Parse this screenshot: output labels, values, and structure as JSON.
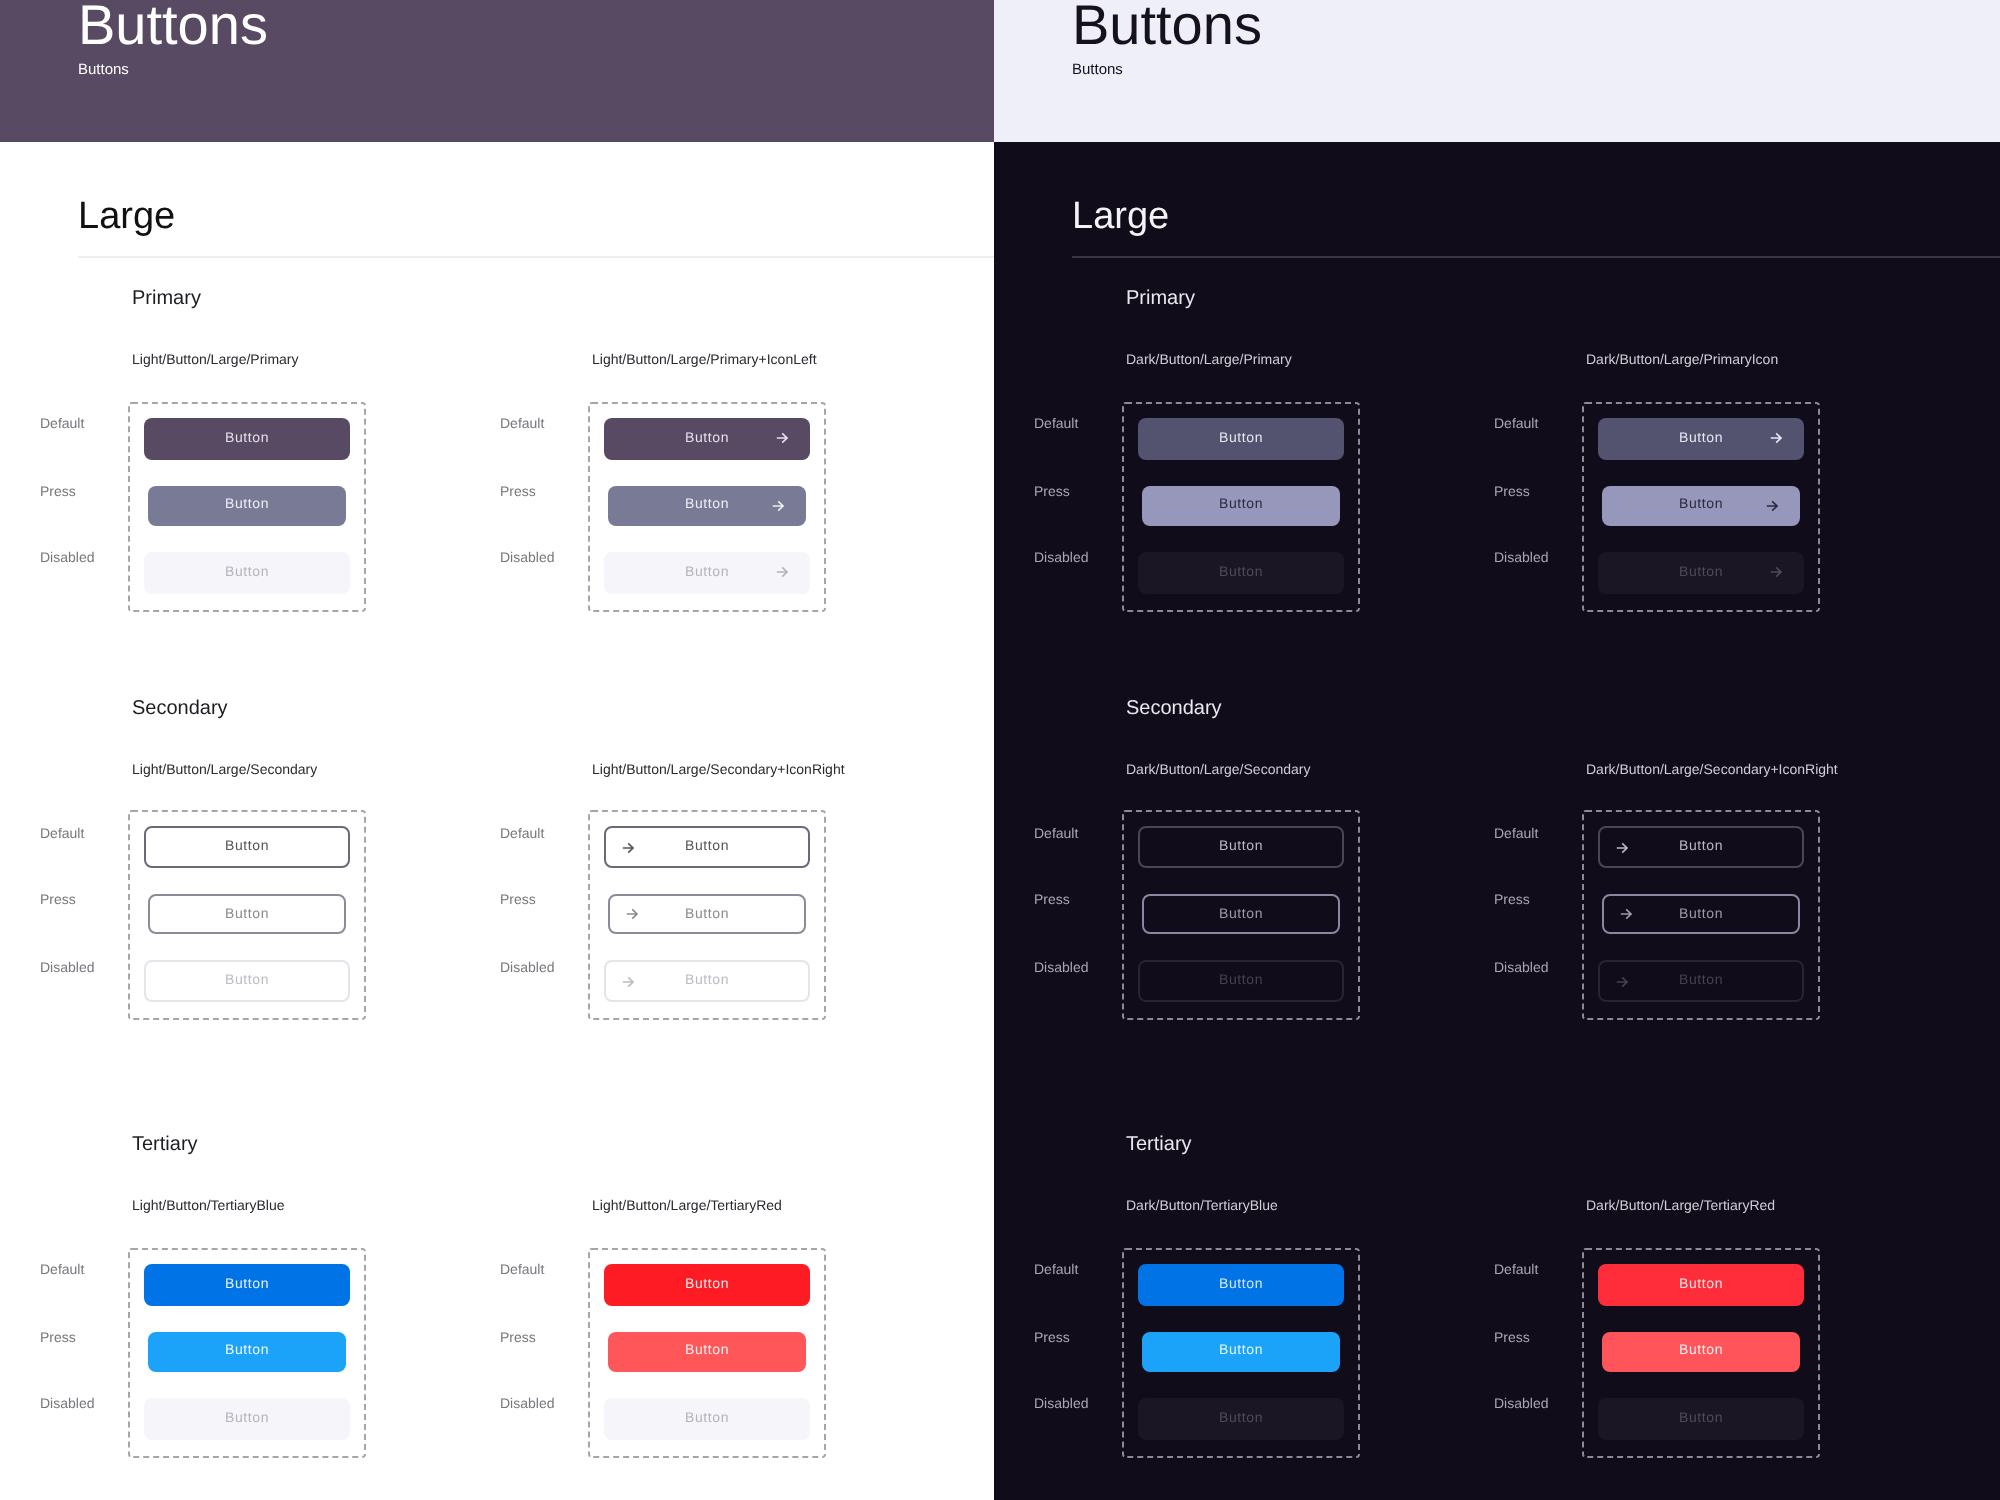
{
  "panels": [
    {
      "kind": "light",
      "header": {
        "title": "Buttons",
        "subtitle": "Buttons"
      },
      "heading": "Large",
      "sections": [
        {
          "title": "Primary",
          "variants": [
            {
              "label": "Light/Button/Large/Primary",
              "kind": "primary",
              "arrow_left": false,
              "arrow_right": false,
              "rows": [
                {
                  "state": "Default",
                  "button": {
                    "text": "Button",
                    "pressed": false,
                    "disabled": false
                  }
                },
                {
                  "state": "Press",
                  "button": {
                    "text": "Button",
                    "pressed": true,
                    "disabled": false
                  }
                },
                {
                  "state": "Disabled",
                  "button": {
                    "text": "Button",
                    "pressed": false,
                    "disabled": true
                  }
                }
              ]
            },
            {
              "label": "Light/Button/Large/Primary+IconLeft",
              "kind": "primary",
              "arrow_left": false,
              "arrow_right": true,
              "rows": [
                {
                  "state": "Default",
                  "button": {
                    "text": "Button",
                    "pressed": false,
                    "disabled": false
                  }
                },
                {
                  "state": "Press",
                  "button": {
                    "text": "Button",
                    "pressed": true,
                    "disabled": false
                  }
                },
                {
                  "state": "Disabled",
                  "button": {
                    "text": "Button",
                    "pressed": false,
                    "disabled": true
                  }
                }
              ]
            }
          ]
        },
        {
          "title": "Secondary",
          "variants": [
            {
              "label": "Light/Button/Large/Secondary",
              "kind": "secondary",
              "arrow_left": false,
              "arrow_right": false,
              "rows": [
                {
                  "state": "Default",
                  "button": {
                    "text": "Button",
                    "pressed": false,
                    "disabled": false
                  }
                },
                {
                  "state": "Press",
                  "button": {
                    "text": "Button",
                    "pressed": true,
                    "disabled": false
                  }
                },
                {
                  "state": "Disabled",
                  "button": {
                    "text": "Button",
                    "pressed": false,
                    "disabled": true
                  }
                }
              ]
            },
            {
              "label": "Light/Button/Large/Secondary+IconRight",
              "kind": "secondary",
              "arrow_left": true,
              "arrow_right": false,
              "rows": [
                {
                  "state": "Default",
                  "button": {
                    "text": "Button",
                    "pressed": false,
                    "disabled": false
                  }
                },
                {
                  "state": "Press",
                  "button": {
                    "text": "Button",
                    "pressed": true,
                    "disabled": false
                  }
                },
                {
                  "state": "Disabled",
                  "button": {
                    "text": "Button",
                    "pressed": false,
                    "disabled": true
                  }
                }
              ]
            }
          ]
        },
        {
          "title": "Tertiary",
          "variants": [
            {
              "label": "Light/Button/TertiaryBlue",
              "kind": "blue",
              "arrow_left": false,
              "arrow_right": false,
              "rows": [
                {
                  "state": "Default",
                  "button": {
                    "text": "Button",
                    "pressed": false,
                    "disabled": false
                  }
                },
                {
                  "state": "Press",
                  "button": {
                    "text": "Button",
                    "pressed": true,
                    "disabled": false
                  }
                },
                {
                  "state": "Disabled",
                  "button": {
                    "text": "Button",
                    "pressed": false,
                    "disabled": true
                  }
                }
              ]
            },
            {
              "label": "Light/Button/Large/TertiaryRed",
              "kind": "red",
              "arrow_left": false,
              "arrow_right": false,
              "rows": [
                {
                  "state": "Default",
                  "button": {
                    "text": "Button",
                    "pressed": false,
                    "disabled": false
                  }
                },
                {
                  "state": "Press",
                  "button": {
                    "text": "Button",
                    "pressed": true,
                    "disabled": false
                  }
                },
                {
                  "state": "Disabled",
                  "button": {
                    "text": "Button",
                    "pressed": false,
                    "disabled": true
                  }
                }
              ]
            }
          ]
        }
      ]
    },
    {
      "kind": "dark",
      "header": {
        "title": "Buttons",
        "subtitle": "Buttons"
      },
      "heading": "Large",
      "sections": [
        {
          "title": "Primary",
          "variants": [
            {
              "label": "Dark/Button/Large/Primary",
              "kind": "primary",
              "arrow_left": false,
              "arrow_right": false,
              "rows": [
                {
                  "state": "Default",
                  "button": {
                    "text": "Button",
                    "pressed": false,
                    "disabled": false
                  }
                },
                {
                  "state": "Press",
                  "button": {
                    "text": "Button",
                    "pressed": true,
                    "disabled": false
                  }
                },
                {
                  "state": "Disabled",
                  "button": {
                    "text": "Button",
                    "pressed": false,
                    "disabled": true
                  }
                }
              ]
            },
            {
              "label": "Dark/Button/Large/PrimaryIcon",
              "kind": "primary",
              "arrow_left": false,
              "arrow_right": true,
              "rows": [
                {
                  "state": "Default",
                  "button": {
                    "text": "Button",
                    "pressed": false,
                    "disabled": false
                  }
                },
                {
                  "state": "Press",
                  "button": {
                    "text": "Button",
                    "pressed": true,
                    "disabled": false
                  }
                },
                {
                  "state": "Disabled",
                  "button": {
                    "text": "Button",
                    "pressed": false,
                    "disabled": true
                  }
                }
              ]
            }
          ]
        },
        {
          "title": "Secondary",
          "variants": [
            {
              "label": "Dark/Button/Large/Secondary",
              "kind": "secondary",
              "arrow_left": false,
              "arrow_right": false,
              "rows": [
                {
                  "state": "Default",
                  "button": {
                    "text": "Button",
                    "pressed": false,
                    "disabled": false
                  }
                },
                {
                  "state": "Press",
                  "button": {
                    "text": "Button",
                    "pressed": true,
                    "disabled": false
                  }
                },
                {
                  "state": "Disabled",
                  "button": {
                    "text": "Button",
                    "pressed": false,
                    "disabled": true
                  }
                }
              ]
            },
            {
              "label": "Dark/Button/Large/Secondary+IconRight",
              "kind": "secondary",
              "arrow_left": true,
              "arrow_right": false,
              "rows": [
                {
                  "state": "Default",
                  "button": {
                    "text": "Button",
                    "pressed": false,
                    "disabled": false
                  }
                },
                {
                  "state": "Press",
                  "button": {
                    "text": "Button",
                    "pressed": true,
                    "disabled": false
                  }
                },
                {
                  "state": "Disabled",
                  "button": {
                    "text": "Button",
                    "pressed": false,
                    "disabled": true
                  }
                }
              ]
            }
          ]
        },
        {
          "title": "Tertiary",
          "variants": [
            {
              "label": "Dark/Button/TertiaryBlue",
              "kind": "blue",
              "arrow_left": false,
              "arrow_right": false,
              "rows": [
                {
                  "state": "Default",
                  "button": {
                    "text": "Button",
                    "pressed": false,
                    "disabled": false
                  }
                },
                {
                  "state": "Press",
                  "button": {
                    "text": "Button",
                    "pressed": true,
                    "disabled": false
                  }
                },
                {
                  "state": "Disabled",
                  "button": {
                    "text": "Button",
                    "pressed": false,
                    "disabled": true
                  }
                }
              ]
            },
            {
              "label": "Dark/Button/Large/TertiaryRed",
              "kind": "red",
              "arrow_left": false,
              "arrow_right": false,
              "rows": [
                {
                  "state": "Default",
                  "button": {
                    "text": "Button",
                    "pressed": false,
                    "disabled": false
                  }
                },
                {
                  "state": "Press",
                  "button": {
                    "text": "Button",
                    "pressed": true,
                    "disabled": false
                  }
                },
                {
                  "state": "Disabled",
                  "button": {
                    "text": "Button",
                    "pressed": false,
                    "disabled": true
                  }
                }
              ]
            }
          ]
        }
      ]
    }
  ]
}
